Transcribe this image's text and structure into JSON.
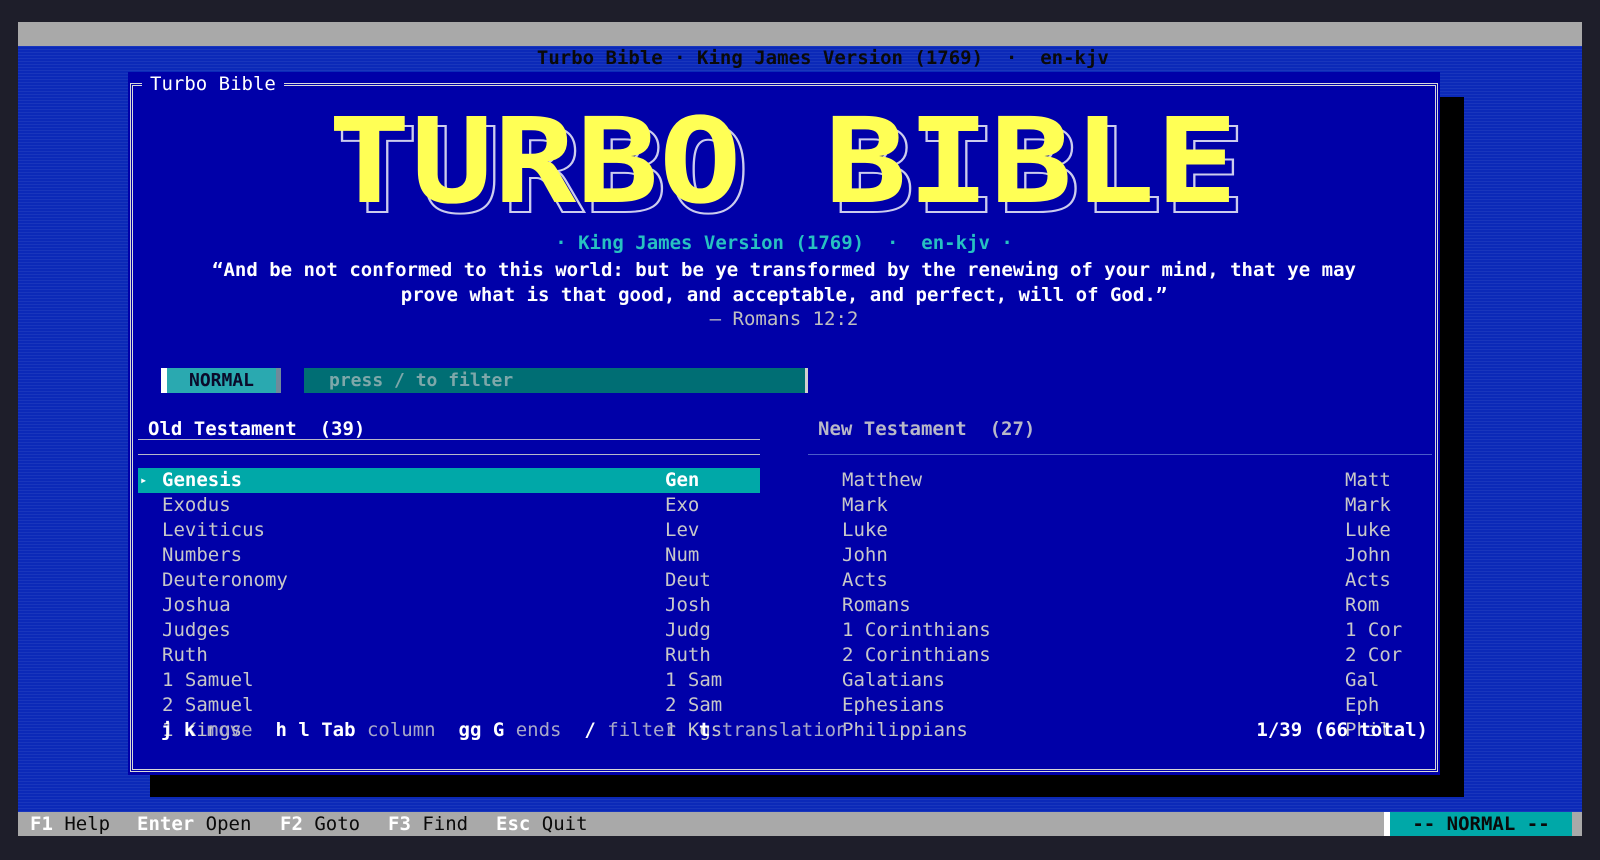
{
  "window": {
    "title": "Turbo Bible · King James Version (1769)  ·  en-kjv"
  },
  "dialog": {
    "title": "Turbo Bible",
    "logo_text": "TURBO BIBLE",
    "subtitle": "· King James Version (1769)  ·  en-kjv ·",
    "verse_line1": "“And be not conformed to this world: but be ye transformed by the renewing of your mind, that ye may",
    "verse_line2": "prove what is that good, and acceptable, and perfect, will of God.”",
    "verse_ref": "— Romans 12:2"
  },
  "mode": {
    "label": "NORMAL"
  },
  "filter": {
    "placeholder": "press / to filter"
  },
  "old_testament": {
    "header": "Old Testament  (39)",
    "books": [
      {
        "name": "Genesis",
        "abbr": "Gen",
        "selected": true
      },
      {
        "name": "Exodus",
        "abbr": "Exo"
      },
      {
        "name": "Leviticus",
        "abbr": "Lev"
      },
      {
        "name": "Numbers",
        "abbr": "Num"
      },
      {
        "name": "Deuteronomy",
        "abbr": "Deut"
      },
      {
        "name": "Joshua",
        "abbr": "Josh"
      },
      {
        "name": "Judges",
        "abbr": "Judg"
      },
      {
        "name": "Ruth",
        "abbr": "Ruth"
      },
      {
        "name": "1 Samuel",
        "abbr": "1 Sam"
      },
      {
        "name": "2 Samuel",
        "abbr": "2 Sam"
      },
      {
        "name": "1 Kings",
        "abbr": "1 Kgs"
      }
    ]
  },
  "new_testament": {
    "header": "New Testament  (27)",
    "books": [
      {
        "name": "Matthew",
        "abbr": "Matt"
      },
      {
        "name": "Mark",
        "abbr": "Mark"
      },
      {
        "name": "Luke",
        "abbr": "Luke"
      },
      {
        "name": "John",
        "abbr": "John"
      },
      {
        "name": "Acts",
        "abbr": "Acts"
      },
      {
        "name": "Romans",
        "abbr": "Rom"
      },
      {
        "name": "1 Corinthians",
        "abbr": "1 Cor"
      },
      {
        "name": "2 Corinthians",
        "abbr": "2 Cor"
      },
      {
        "name": "Galatians",
        "abbr": "Gal"
      },
      {
        "name": "Ephesians",
        "abbr": "Eph"
      },
      {
        "name": "Philippians",
        "abbr": "Phil"
      }
    ]
  },
  "hints": {
    "k1": "j k",
    "l1": "move",
    "k2": "h l Tab",
    "l2": "column",
    "k3": "gg G",
    "l3": "ends",
    "k4": "/",
    "l4": "filter",
    "k5": "t",
    "l5": "translation"
  },
  "position": "1/39 (66 total)",
  "statusbar": {
    "items": [
      {
        "key": "F1",
        "label": "Help"
      },
      {
        "key": "Enter",
        "label": "Open"
      },
      {
        "key": "F2",
        "label": "Goto"
      },
      {
        "key": "F3",
        "label": "Find"
      },
      {
        "key": "Esc",
        "label": "Quit"
      }
    ],
    "mode": "-- NORMAL --"
  },
  "colors": {
    "screen_bg": "#0b29b8",
    "dialog_bg": "#0000a8",
    "logo_yellow": "#ffff55",
    "accent_cyan": "#00a8a8",
    "bar_gray": "#a9a9a9"
  }
}
